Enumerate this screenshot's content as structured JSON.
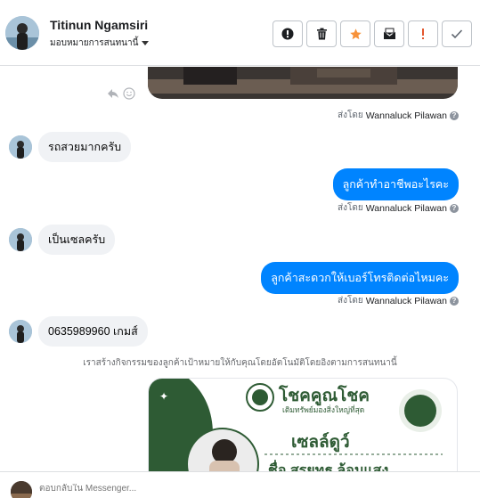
{
  "header": {
    "name": "Titinun Ngamsiri",
    "subtitle": "มอบหมายการสนทนานี้",
    "actions": [
      "block",
      "delete",
      "star",
      "mark-unread",
      "spam",
      "done"
    ]
  },
  "chat": {
    "sent_prefix": "ส่งโดย",
    "messages": [
      {
        "dir": "out",
        "type": "image",
        "sent_by": "Wannaluck Pilawan"
      },
      {
        "dir": "in",
        "text": "รถสวยมากครับ"
      },
      {
        "dir": "out",
        "text": "ลูกค้าทำอาชีพอะไรคะ",
        "sent_by": "Wannaluck Pilawan"
      },
      {
        "dir": "in",
        "text": "เป็นเซลครับ"
      },
      {
        "dir": "out",
        "text": "ลูกค้าสะดวกให้เบอร์โทรติดต่อไหมคะ",
        "sent_by": "Wannaluck Pilawan"
      },
      {
        "dir": "in",
        "text": "0635989960 เกมส์"
      }
    ],
    "notice": "เราสร้างกิจกรรมของลูกค้าเป้าหมายให้กับคุณโดยอัตโนมัติโดยอิงตามการสนทนานี้",
    "card": {
      "brand": "โชคคูณโชค",
      "tagline": "เติมทรัพย์มองสิ่งใหญ่ที่สุด",
      "headline": "เซลล์ดูว์",
      "name_line": "ชื่อ สรยุทธ ล้อมแสง"
    }
  },
  "footer": {
    "placeholder": "ตอบกลับใน Messenger..."
  },
  "colors": {
    "accent": "#0084ff",
    "incoming_bubble": "#f0f2f5",
    "card_green": "#2e5b34"
  }
}
